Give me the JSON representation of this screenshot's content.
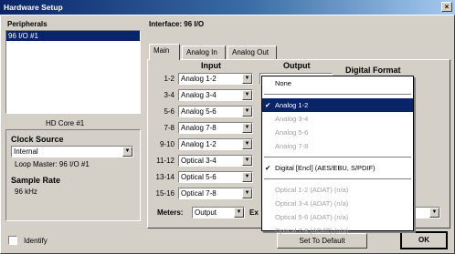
{
  "window": {
    "title": "Hardware Setup",
    "close_glyph": "×"
  },
  "peripherals": {
    "label": "Peripherals",
    "items": [
      "96 I/O #1"
    ]
  },
  "interface": {
    "label": "Interface:",
    "value": "96 I/O"
  },
  "hd_core": "HD Core #1",
  "clock": {
    "label": "Clock Source",
    "value": "Internal",
    "loop_master": "Loop Master: 96 I/O #1",
    "rate_label": "Sample Rate",
    "rate_value": "96 kHz"
  },
  "tabs": [
    "Main",
    "Analog In",
    "Analog Out"
  ],
  "io_table": {
    "input_header": "Input",
    "output_header": "Output",
    "rows": [
      {
        "label": "1-2",
        "input": "Analog 1-2"
      },
      {
        "label": "3-4",
        "input": "Analog 3-4"
      },
      {
        "label": "5-6",
        "input": "Analog 5-6"
      },
      {
        "label": "7-8",
        "input": "Analog 7-8"
      },
      {
        "label": "9-10",
        "input": "Analog 1-2"
      },
      {
        "label": "11-12",
        "input": "Optical 3-4"
      },
      {
        "label": "13-14",
        "input": "Optical 5-6"
      },
      {
        "label": "15-16",
        "input": "Optical 7-8"
      }
    ]
  },
  "digital_format_label": "Digital Format",
  "meters": {
    "label": "Meters:",
    "value": "Output",
    "ext_label": "Ex"
  },
  "dropdown": {
    "items": [
      {
        "label": "None",
        "state": "normal"
      },
      {
        "label": "Analog 1-2",
        "state": "highlighted",
        "checked": true
      },
      {
        "label": "Analog 3-4",
        "state": "disabled"
      },
      {
        "label": "Analog 5-6",
        "state": "disabled"
      },
      {
        "label": "Analog 7-8",
        "state": "disabled"
      },
      {
        "label": "Digital [Encl] (AES/EBU, S/PDIF)",
        "state": "normal",
        "checked": true
      },
      {
        "label": "Optical 1-2 (ADAT) (n/a)",
        "state": "disabled"
      },
      {
        "label": "Optical 3-4 (ADAT) (n/a)",
        "state": "disabled"
      },
      {
        "label": "Optical 5-6 (ADAT) (n/a)",
        "state": "disabled"
      },
      {
        "label": "Optical 7-8 (ADAT) (n/a)",
        "state": "disabled"
      }
    ]
  },
  "identify_label": "Identify",
  "set_default_label": "Set To Default",
  "ok_label": "OK",
  "colors": {
    "titlebar": "#0a246a",
    "highlight": "#0a246a",
    "face": "#d4d0c8"
  },
  "icons": {
    "dropdown_arrow": "▼",
    "check": "✔"
  }
}
